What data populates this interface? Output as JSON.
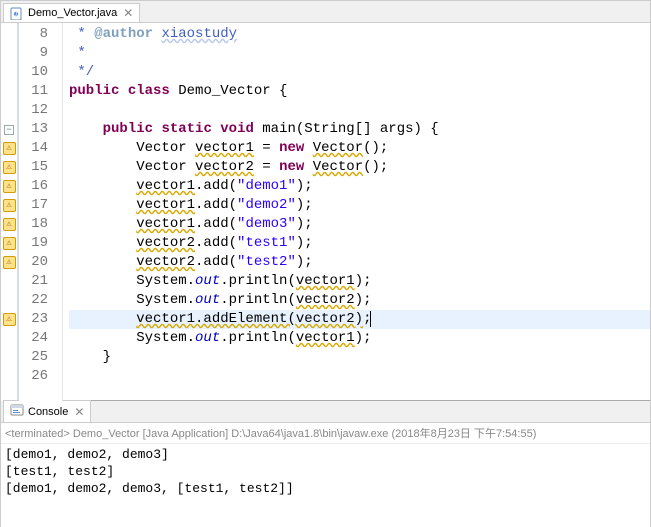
{
  "tab": {
    "filename": "Demo_Vector.java",
    "close_glyph": "✕"
  },
  "code": {
    "lines": [
      {
        "n": 8,
        "icon": "",
        "html": " <span class='jd'>*</span> <span class='jdt'>@author</span> <span class='jda'>xiaostudy</span>"
      },
      {
        "n": 9,
        "icon": "",
        "html": " <span class='jd'>*</span>"
      },
      {
        "n": 10,
        "icon": "",
        "html": " <span class='jd'>*/</span>"
      },
      {
        "n": 11,
        "icon": "",
        "html": "<span class='kw'>public</span> <span class='kw'>class</span> Demo_Vector {"
      },
      {
        "n": 12,
        "icon": "",
        "html": ""
      },
      {
        "n": 13,
        "icon": "fold",
        "html": "    <span class='kw'>public</span> <span class='kw'>static</span> <span class='kw'>void</span> main(String[] args) {"
      },
      {
        "n": 14,
        "icon": "warn",
        "html": "        Vector <span class='warn-u'>vector1</span> = <span class='kw'>new</span> <span class='warn-u'>Vector</span>();"
      },
      {
        "n": 15,
        "icon": "warn",
        "html": "        Vector <span class='warn-u'>vector2</span> = <span class='kw'>new</span> <span class='warn-u'>Vector</span>();"
      },
      {
        "n": 16,
        "icon": "warn",
        "html": "        <span class='warn-u'>vector1</span>.add(<span class='str'>\"demo1\"</span>);"
      },
      {
        "n": 17,
        "icon": "warn",
        "html": "        <span class='warn-u'>vector1</span>.add(<span class='str'>\"demo2\"</span>);"
      },
      {
        "n": 18,
        "icon": "warn",
        "html": "        <span class='warn-u'>vector1</span>.add(<span class='str'>\"demo3\"</span>);"
      },
      {
        "n": 19,
        "icon": "warn",
        "html": "        <span class='warn-u'>vector2</span>.add(<span class='str'>\"test1\"</span>);"
      },
      {
        "n": 20,
        "icon": "warn",
        "html": "        <span class='warn-u'>vector2</span>.add(<span class='str'>\"test2\"</span>);"
      },
      {
        "n": 21,
        "icon": "",
        "html": "        System.<span class='fld'>out</span>.println(<span class='warn-u'>vector1</span>);"
      },
      {
        "n": 22,
        "icon": "",
        "html": "        System.<span class='fld'>out</span>.println(<span class='warn-u'>vector2</span>);"
      },
      {
        "n": 23,
        "icon": "warn",
        "html": "        <span class='warn-u'>vector1.addElement(vector2)</span>;<span class='cursor'></span>",
        "highlight": true
      },
      {
        "n": 24,
        "icon": "",
        "html": "        System.<span class='fld'>out</span>.println(<span class='warn-u'>vector1</span>);"
      },
      {
        "n": 25,
        "icon": "",
        "html": "    }"
      },
      {
        "n": 26,
        "icon": "",
        "html": ""
      }
    ]
  },
  "console": {
    "tab_label": "Console",
    "status": "<terminated> Demo_Vector [Java Application] D:\\Java64\\java1.8\\bin\\javaw.exe (2018年8月23日 下午7:54:55)",
    "output": [
      "[demo1, demo2, demo3]",
      "[test1, test2]",
      "[demo1, demo2, demo3, [test1, test2]]"
    ]
  }
}
